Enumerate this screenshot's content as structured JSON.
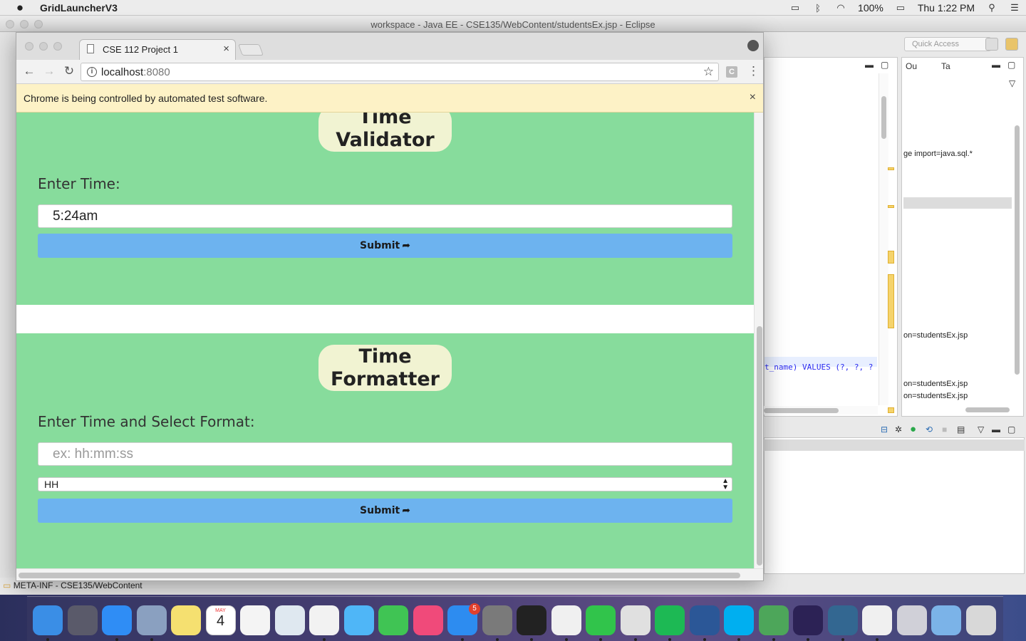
{
  "menubar": {
    "app_name": "GridLauncherV3",
    "battery": "100%",
    "clock": "Thu 1:22 PM"
  },
  "eclipse": {
    "window_title": "workspace - Java EE - CSE135/WebContent/studentsEx.jsp - Eclipse",
    "quick_access_placeholder": "Quick Access",
    "outline_tabs": [
      "Ou",
      "Ta"
    ],
    "outline_lines": [
      "ge import=java.sql.*",
      "on=studentsEx.jsp",
      "on=studentsEx.jsp",
      "on=studentsEx.jsp"
    ],
    "editor_code": "t_name) VALUES (?, ?, ?",
    "status_text": "META-INF - CSE135/WebContent"
  },
  "chrome": {
    "tab_title": "CSE 112 Project 1",
    "url_host": "localhost",
    "url_port": ":8080",
    "ext_letter": "C",
    "infobar_text": "Chrome is being controlled by automated test software."
  },
  "validator": {
    "title_line1": "Time",
    "title_line2": "Validator",
    "label": "Enter Time:",
    "input_value": "5:24am",
    "submit_label": "Submit"
  },
  "formatter": {
    "title_line1": "Time",
    "title_line2": "Formatter",
    "label": "Enter Time and Select Format:",
    "input_placeholder": "ex: hh:mm:ss",
    "select_value": "HH",
    "submit_label": "Submit"
  },
  "dock": {
    "apps": [
      "finder",
      "launchpad",
      "safari",
      "mail",
      "notes",
      "calendar",
      "reminders",
      "preview",
      "photos",
      "messages",
      "facetime",
      "itunes",
      "app-store",
      "system-preferences",
      "terminal",
      "chrome",
      "line",
      "sublime",
      "spotify",
      "word",
      "skype",
      "vim",
      "eclipse",
      "postgres",
      "chrome-2",
      "file",
      "downloads",
      "trash"
    ],
    "calendar_month": "MAY",
    "calendar_day": "4",
    "app_store_badge": "5",
    "colors": {
      "finder": "#3a8ee6",
      "launchpad": "#5a5a6a",
      "safari": "#2f8df5",
      "mail": "#8aa0c0",
      "notes": "#f5e070",
      "calendar": "#ffffff",
      "reminders": "#f4f4f4",
      "preview": "#dfe8f0",
      "photos": "#f2f2f2",
      "messages": "#4fb6f7",
      "facetime": "#40c454",
      "itunes": "#f04a7a",
      "app-store": "#2d8cf0",
      "system-preferences": "#7a7a7a",
      "terminal": "#222222",
      "chrome": "#f0f0f0",
      "line": "#31c44b",
      "sublime": "#e0e0e0",
      "spotify": "#1db954",
      "word": "#2b5797",
      "skype": "#00aff0",
      "vim": "#4da65a",
      "eclipse": "#2c2255",
      "postgres": "#336791",
      "chrome-2": "#f0f0f0",
      "file": "#d0d0d8",
      "downloads": "#7bb3e8",
      "trash": "#d8d8d8"
    }
  }
}
